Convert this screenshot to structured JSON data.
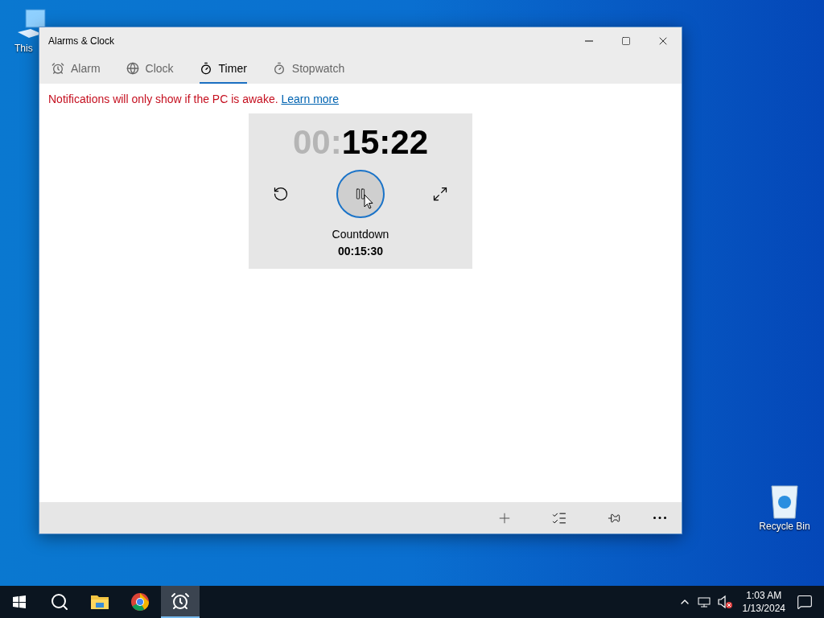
{
  "desktop": {
    "this_pc": "This",
    "recycle_bin": "Recycle Bin"
  },
  "window": {
    "title": "Alarms & Clock"
  },
  "tabs": [
    {
      "label": "Alarm",
      "kind": "alarm",
      "selected": false
    },
    {
      "label": "Clock",
      "kind": "clock",
      "selected": false
    },
    {
      "label": "Timer",
      "kind": "timer",
      "selected": true
    },
    {
      "label": "Stopwatch",
      "kind": "stopwatch",
      "selected": false
    }
  ],
  "notice": {
    "text": "Notifications will only show if the PC is awake.",
    "link": "Learn more"
  },
  "timer": {
    "time_dim": "00:",
    "time_main": "15:22",
    "running": true,
    "label": "Countdown",
    "duration": "00:15:30"
  },
  "taskbar": {
    "apps": [
      {
        "kind": "search",
        "selected": false
      },
      {
        "kind": "folder",
        "selected": false
      },
      {
        "kind": "chrome",
        "selected": false
      },
      {
        "kind": "alarms",
        "selected": true
      }
    ],
    "time": "1:03 AM",
    "date": "1/13/2024"
  }
}
